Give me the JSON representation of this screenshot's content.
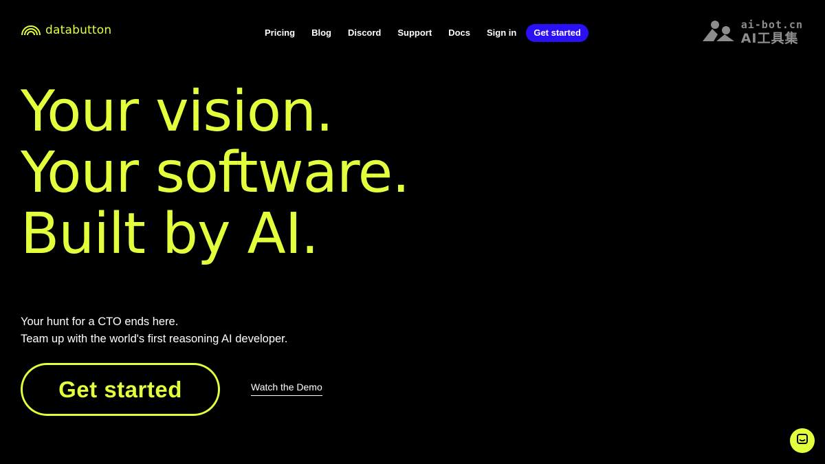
{
  "header": {
    "logo_text": "databutton",
    "nav": [
      {
        "label": "Pricing"
      },
      {
        "label": "Blog"
      },
      {
        "label": "Discord"
      },
      {
        "label": "Support"
      },
      {
        "label": "Docs"
      },
      {
        "label": "Sign in"
      }
    ],
    "cta_label": "Get started"
  },
  "watermark": {
    "domain": "ai-bot.cn",
    "name": "AI工具集"
  },
  "hero": {
    "lines": [
      "Your vision.",
      "Your software.",
      "Built by AI."
    ],
    "subtitle_lines": [
      "Your hunt for a CTO ends here.",
      "Team up with the world's first reasoning AI developer."
    ],
    "primary_button": "Get started",
    "demo_link": "Watch the Demo"
  },
  "chat": {
    "icon": "chat-icon"
  },
  "colors": {
    "background": "#000000",
    "accent": "#e4ff3c",
    "cta_blue": "#2b10f5",
    "text": "#ffffff"
  }
}
